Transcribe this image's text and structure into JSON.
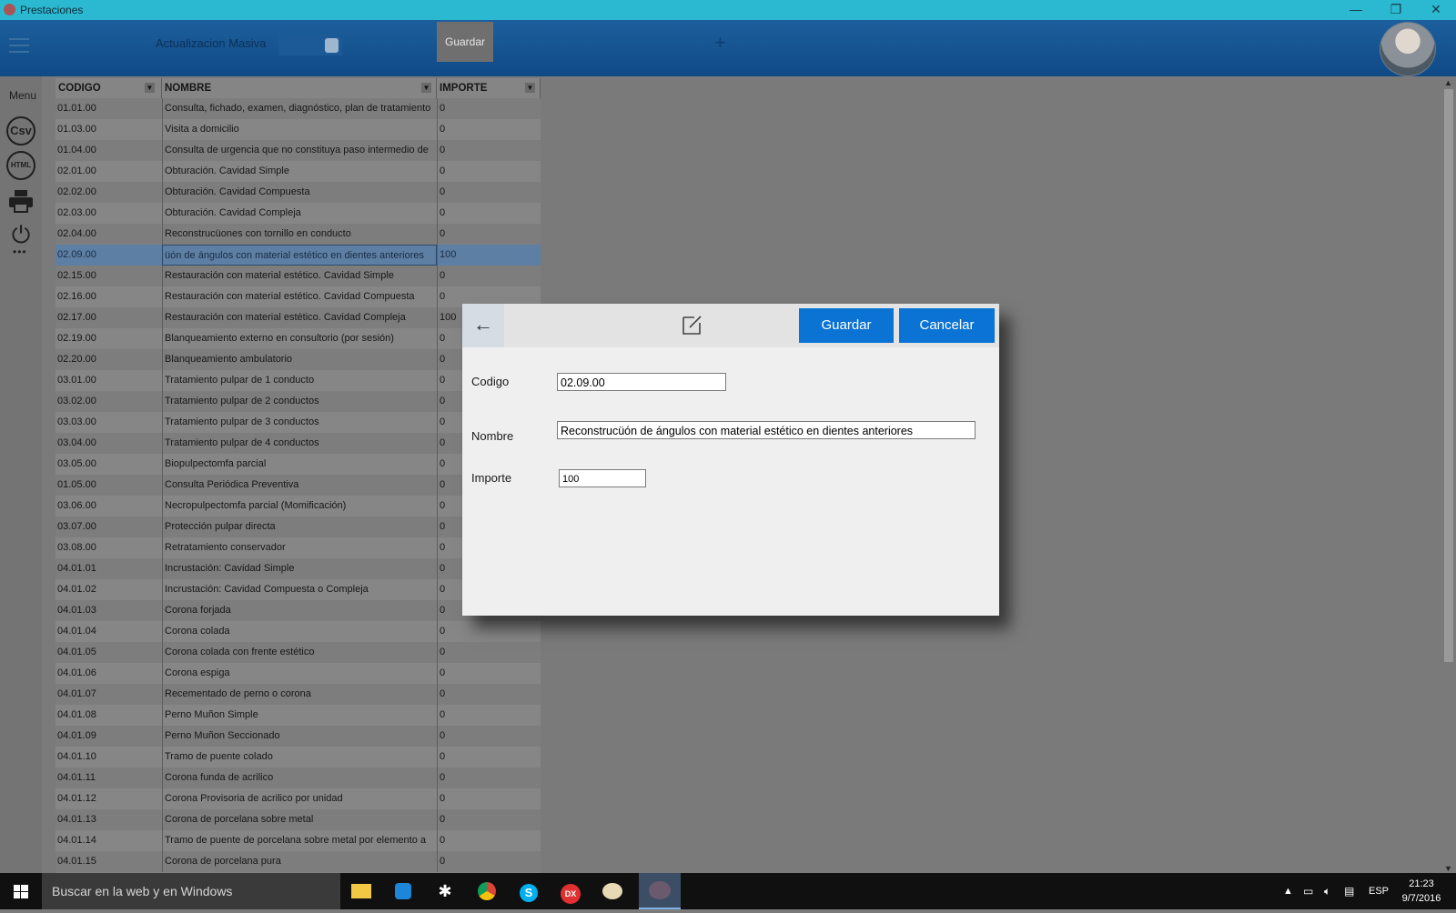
{
  "window": {
    "title": "Prestaciones",
    "min": "—",
    "restore": "❐",
    "close": "✕"
  },
  "appbar": {
    "massive_update_label": "Actualizacion Masiva",
    "save_label": "Guardar",
    "add_glyph": "+"
  },
  "sidebar": {
    "menu_label": "Menu",
    "csv_label": "Csv",
    "html_label": "HTML",
    "more": "•••"
  },
  "grid": {
    "columns": [
      "CODIGO",
      "NOMBRE",
      "IMPORTE"
    ],
    "selected_index": 7,
    "rows": [
      {
        "codigo": "01.01.00",
        "nombre": "Consulta, fichado, examen, diagnóstico, plan de tratamiento",
        "importe": "0"
      },
      {
        "codigo": "01.03.00",
        "nombre": "Visita a domicilio",
        "importe": "0"
      },
      {
        "codigo": "01.04.00",
        "nombre": "Consulta de urgencia que no constituya paso intermedio de",
        "importe": "0"
      },
      {
        "codigo": "02.01.00",
        "nombre": "Obturación. Cavidad Simple",
        "importe": "0"
      },
      {
        "codigo": "02.02.00",
        "nombre": "Obturación. Cavidad Compuesta",
        "importe": "0"
      },
      {
        "codigo": "02.03.00",
        "nombre": "Obturación. Cavidad Compleja",
        "importe": "0"
      },
      {
        "codigo": "02.04.00",
        "nombre": "Reconstrucüones con tornillo en conducto",
        "importe": "0"
      },
      {
        "codigo": "02.09.00",
        "nombre": "üón de ángulos con material estético en dientes anteriores",
        "importe": "100"
      },
      {
        "codigo": "02.15.00",
        "nombre": "Restauración con material estético. Cavidad Simple",
        "importe": "0"
      },
      {
        "codigo": "02.16.00",
        "nombre": "Restauración con material estético. Cavidad Compuesta",
        "importe": "0"
      },
      {
        "codigo": "02.17.00",
        "nombre": "Restauración con material estético. Cavidad Compleja",
        "importe": "100"
      },
      {
        "codigo": "02.19.00",
        "nombre": "Blanqueamiento externo en consultorio (por sesión)",
        "importe": "0"
      },
      {
        "codigo": "02.20.00",
        "nombre": "Blanqueamiento   ambulatorio",
        "importe": "0"
      },
      {
        "codigo": "03.01.00",
        "nombre": "Tratamiento pulpar de 1 conducto",
        "importe": "0"
      },
      {
        "codigo": "03.02.00",
        "nombre": "Tratamiento pulpar de 2 conductos",
        "importe": "0"
      },
      {
        "codigo": "03.03.00",
        "nombre": "Tratamiento pulpar de 3 conductos",
        "importe": "0"
      },
      {
        "codigo": "03.04.00",
        "nombre": "Tratamiento pulpar de 4 conductos",
        "importe": "0"
      },
      {
        "codigo": "03.05.00",
        "nombre": "Biopulpectomfa  parcial",
        "importe": "0"
      },
      {
        "codigo": "01.05.00",
        "nombre": "Consulta Periódica Preventiva",
        "importe": "0"
      },
      {
        "codigo": "03.06.00",
        "nombre": "Necropulpectomfa  parcial (Momificación)",
        "importe": "0"
      },
      {
        "codigo": "03.07.00",
        "nombre": "Protección pulpar directa",
        "importe": "0"
      },
      {
        "codigo": "03.08.00",
        "nombre": "Retratamiento conservador",
        "importe": "0"
      },
      {
        "codigo": "04.01.01",
        "nombre": "Incrustación: Cavidad Simple",
        "importe": "0"
      },
      {
        "codigo": "04.01.02",
        "nombre": "Incrustación: Cavidad Compuesta o Compleja",
        "importe": "0"
      },
      {
        "codigo": "04.01.03",
        "nombre": "Corona forjada",
        "importe": "0"
      },
      {
        "codigo": "04.01.04",
        "nombre": "Corona colada",
        "importe": "0"
      },
      {
        "codigo": "04.01.05",
        "nombre": "Corona colada con frente estético",
        "importe": "0"
      },
      {
        "codigo": "04.01.06",
        "nombre": "Corona espiga",
        "importe": "0"
      },
      {
        "codigo": "04.01.07",
        "nombre": "Recementado de perno o corona",
        "importe": "0"
      },
      {
        "codigo": "04.01.08",
        "nombre": "Perno Muñon Simple",
        "importe": "0"
      },
      {
        "codigo": "04.01.09",
        "nombre": "Perno Muñon Seccionado",
        "importe": "0"
      },
      {
        "codigo": "04.01.10",
        "nombre": "Tramo de puente colado",
        "importe": "0"
      },
      {
        "codigo": "04.01.11",
        "nombre": "Corona funda de acrilico",
        "importe": "0"
      },
      {
        "codigo": "04.01.12",
        "nombre": "Corona Provisoria de acrilico por unidad",
        "importe": "0"
      },
      {
        "codigo": "04.01.13",
        "nombre": "Corona de porcelana sobre metal",
        "importe": "0"
      },
      {
        "codigo": "04.01.14",
        "nombre": "Tramo de puente de porcelana sobre metal por elemento a",
        "importe": "0"
      },
      {
        "codigo": "04.01.15",
        "nombre": "Corona de porcelana pura",
        "importe": "0"
      }
    ]
  },
  "dialog": {
    "back_glyph": "←",
    "save_label": "Guardar",
    "cancel_label": "Cancelar",
    "codigo_label": "Codigo",
    "codigo_value": "02.09.00",
    "nombre_label": "Nombre",
    "nombre_value": "Reconstrucüón de ángulos con material estético en dientes anteriores",
    "importe_label": "Importe",
    "importe_value": "100"
  },
  "taskbar": {
    "search_placeholder": "Buscar en la web y en Windows",
    "apps": [
      "file-explorer-icon",
      "teamviewer-icon",
      "slack-icon",
      "chrome-icon",
      "skype-icon",
      "devexpress-icon",
      "paint-icon",
      "prestaciones-app-icon"
    ],
    "lang": "ESP",
    "time": "21:23",
    "date": "9/7/2016"
  },
  "colors": {
    "titlebar": "#2bb9d1",
    "appbar": "#0f4a87",
    "accent": "#0a73d3",
    "selected_row": "#5d7fa3"
  }
}
